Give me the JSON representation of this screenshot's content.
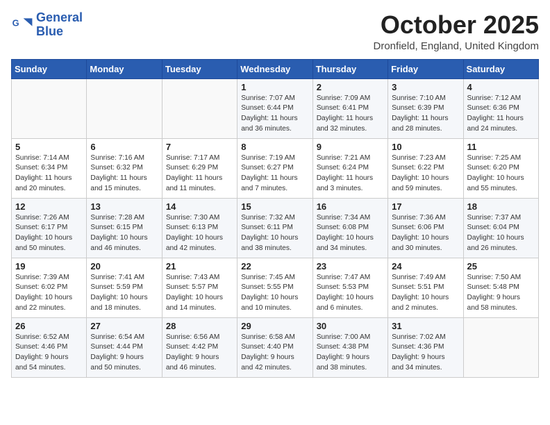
{
  "header": {
    "logo_line1": "General",
    "logo_line2": "Blue",
    "month": "October 2025",
    "location": "Dronfield, England, United Kingdom"
  },
  "days_of_week": [
    "Sunday",
    "Monday",
    "Tuesday",
    "Wednesday",
    "Thursday",
    "Friday",
    "Saturday"
  ],
  "weeks": [
    [
      {
        "day": "",
        "info": ""
      },
      {
        "day": "",
        "info": ""
      },
      {
        "day": "",
        "info": ""
      },
      {
        "day": "1",
        "info": "Sunrise: 7:07 AM\nSunset: 6:44 PM\nDaylight: 11 hours\nand 36 minutes."
      },
      {
        "day": "2",
        "info": "Sunrise: 7:09 AM\nSunset: 6:41 PM\nDaylight: 11 hours\nand 32 minutes."
      },
      {
        "day": "3",
        "info": "Sunrise: 7:10 AM\nSunset: 6:39 PM\nDaylight: 11 hours\nand 28 minutes."
      },
      {
        "day": "4",
        "info": "Sunrise: 7:12 AM\nSunset: 6:36 PM\nDaylight: 11 hours\nand 24 minutes."
      }
    ],
    [
      {
        "day": "5",
        "info": "Sunrise: 7:14 AM\nSunset: 6:34 PM\nDaylight: 11 hours\nand 20 minutes."
      },
      {
        "day": "6",
        "info": "Sunrise: 7:16 AM\nSunset: 6:32 PM\nDaylight: 11 hours\nand 15 minutes."
      },
      {
        "day": "7",
        "info": "Sunrise: 7:17 AM\nSunset: 6:29 PM\nDaylight: 11 hours\nand 11 minutes."
      },
      {
        "day": "8",
        "info": "Sunrise: 7:19 AM\nSunset: 6:27 PM\nDaylight: 11 hours\nand 7 minutes."
      },
      {
        "day": "9",
        "info": "Sunrise: 7:21 AM\nSunset: 6:24 PM\nDaylight: 11 hours\nand 3 minutes."
      },
      {
        "day": "10",
        "info": "Sunrise: 7:23 AM\nSunset: 6:22 PM\nDaylight: 10 hours\nand 59 minutes."
      },
      {
        "day": "11",
        "info": "Sunrise: 7:25 AM\nSunset: 6:20 PM\nDaylight: 10 hours\nand 55 minutes."
      }
    ],
    [
      {
        "day": "12",
        "info": "Sunrise: 7:26 AM\nSunset: 6:17 PM\nDaylight: 10 hours\nand 50 minutes."
      },
      {
        "day": "13",
        "info": "Sunrise: 7:28 AM\nSunset: 6:15 PM\nDaylight: 10 hours\nand 46 minutes."
      },
      {
        "day": "14",
        "info": "Sunrise: 7:30 AM\nSunset: 6:13 PM\nDaylight: 10 hours\nand 42 minutes."
      },
      {
        "day": "15",
        "info": "Sunrise: 7:32 AM\nSunset: 6:11 PM\nDaylight: 10 hours\nand 38 minutes."
      },
      {
        "day": "16",
        "info": "Sunrise: 7:34 AM\nSunset: 6:08 PM\nDaylight: 10 hours\nand 34 minutes."
      },
      {
        "day": "17",
        "info": "Sunrise: 7:36 AM\nSunset: 6:06 PM\nDaylight: 10 hours\nand 30 minutes."
      },
      {
        "day": "18",
        "info": "Sunrise: 7:37 AM\nSunset: 6:04 PM\nDaylight: 10 hours\nand 26 minutes."
      }
    ],
    [
      {
        "day": "19",
        "info": "Sunrise: 7:39 AM\nSunset: 6:02 PM\nDaylight: 10 hours\nand 22 minutes."
      },
      {
        "day": "20",
        "info": "Sunrise: 7:41 AM\nSunset: 5:59 PM\nDaylight: 10 hours\nand 18 minutes."
      },
      {
        "day": "21",
        "info": "Sunrise: 7:43 AM\nSunset: 5:57 PM\nDaylight: 10 hours\nand 14 minutes."
      },
      {
        "day": "22",
        "info": "Sunrise: 7:45 AM\nSunset: 5:55 PM\nDaylight: 10 hours\nand 10 minutes."
      },
      {
        "day": "23",
        "info": "Sunrise: 7:47 AM\nSunset: 5:53 PM\nDaylight: 10 hours\nand 6 minutes."
      },
      {
        "day": "24",
        "info": "Sunrise: 7:49 AM\nSunset: 5:51 PM\nDaylight: 10 hours\nand 2 minutes."
      },
      {
        "day": "25",
        "info": "Sunrise: 7:50 AM\nSunset: 5:48 PM\nDaylight: 9 hours\nand 58 minutes."
      }
    ],
    [
      {
        "day": "26",
        "info": "Sunrise: 6:52 AM\nSunset: 4:46 PM\nDaylight: 9 hours\nand 54 minutes."
      },
      {
        "day": "27",
        "info": "Sunrise: 6:54 AM\nSunset: 4:44 PM\nDaylight: 9 hours\nand 50 minutes."
      },
      {
        "day": "28",
        "info": "Sunrise: 6:56 AM\nSunset: 4:42 PM\nDaylight: 9 hours\nand 46 minutes."
      },
      {
        "day": "29",
        "info": "Sunrise: 6:58 AM\nSunset: 4:40 PM\nDaylight: 9 hours\nand 42 minutes."
      },
      {
        "day": "30",
        "info": "Sunrise: 7:00 AM\nSunset: 4:38 PM\nDaylight: 9 hours\nand 38 minutes."
      },
      {
        "day": "31",
        "info": "Sunrise: 7:02 AM\nSunset: 4:36 PM\nDaylight: 9 hours\nand 34 minutes."
      },
      {
        "day": "",
        "info": ""
      }
    ]
  ]
}
